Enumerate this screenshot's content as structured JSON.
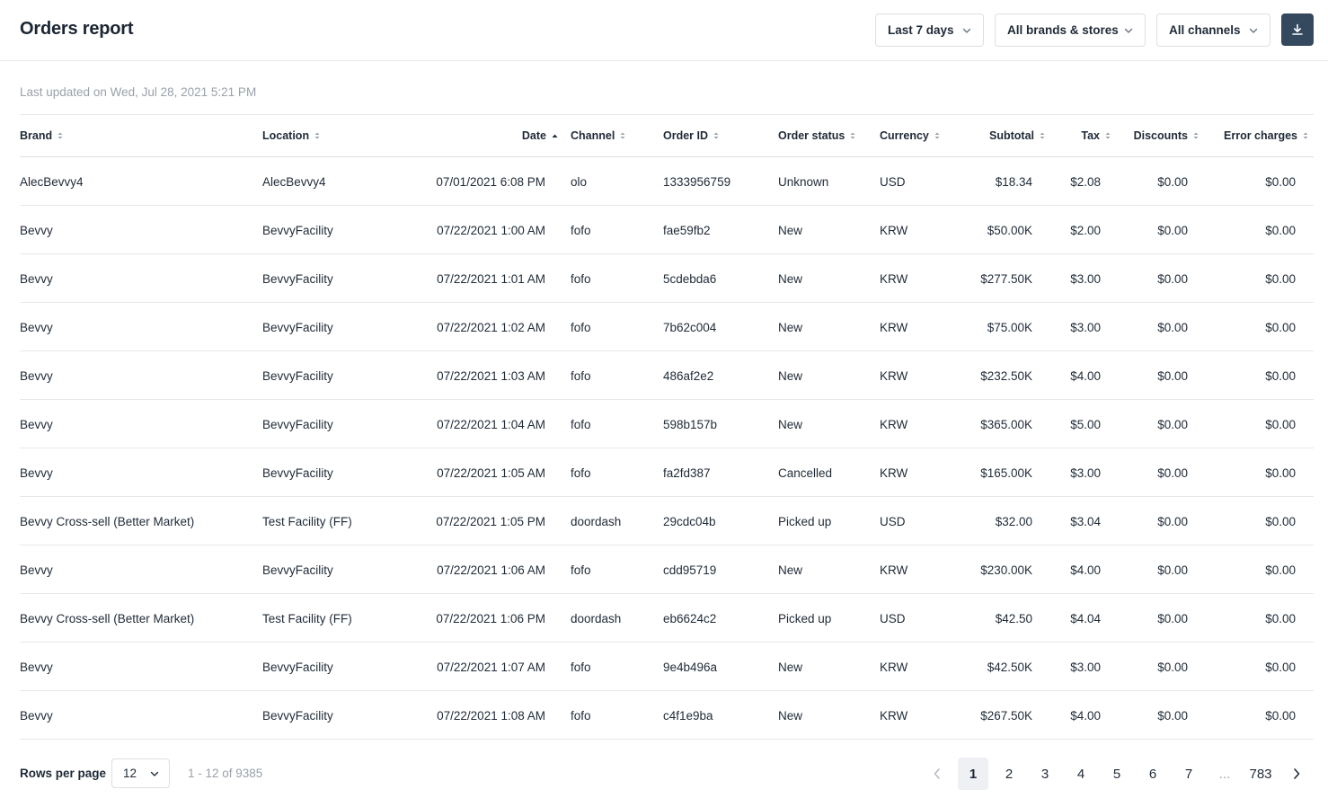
{
  "header": {
    "title": "Orders report",
    "filters": {
      "date_range": "Last 7 days",
      "brands": "All brands & stores",
      "channels": "All channels"
    },
    "download_icon": "download-icon"
  },
  "last_updated": "Last updated on Wed, Jul 28, 2021 5:21 PM",
  "table": {
    "columns": [
      "Brand",
      "Location",
      "Date",
      "Channel",
      "Order ID",
      "Order status",
      "Currency",
      "Subtotal",
      "Tax",
      "Discounts",
      "Error charges"
    ],
    "sorted_by": "Date",
    "sort_direction": "ascending",
    "rows": [
      [
        "AlecBevvy4",
        "AlecBevvy4",
        "07/01/2021 6:08 PM",
        "olo",
        "1333956759",
        "Unknown",
        "USD",
        "$18.34",
        "$2.08",
        "$0.00",
        "$0.00"
      ],
      [
        "Bevvy",
        "BevvyFacility",
        "07/22/2021 1:00 AM",
        "fofo",
        "fae59fb2",
        "New",
        "KRW",
        "$50.00K",
        "$2.00",
        "$0.00",
        "$0.00"
      ],
      [
        "Bevvy",
        "BevvyFacility",
        "07/22/2021 1:01 AM",
        "fofo",
        "5cdebda6",
        "New",
        "KRW",
        "$277.50K",
        "$3.00",
        "$0.00",
        "$0.00"
      ],
      [
        "Bevvy",
        "BevvyFacility",
        "07/22/2021 1:02 AM",
        "fofo",
        "7b62c004",
        "New",
        "KRW",
        "$75.00K",
        "$3.00",
        "$0.00",
        "$0.00"
      ],
      [
        "Bevvy",
        "BevvyFacility",
        "07/22/2021 1:03 AM",
        "fofo",
        "486af2e2",
        "New",
        "KRW",
        "$232.50K",
        "$4.00",
        "$0.00",
        "$0.00"
      ],
      [
        "Bevvy",
        "BevvyFacility",
        "07/22/2021 1:04 AM",
        "fofo",
        "598b157b",
        "New",
        "KRW",
        "$365.00K",
        "$5.00",
        "$0.00",
        "$0.00"
      ],
      [
        "Bevvy",
        "BevvyFacility",
        "07/22/2021 1:05 AM",
        "fofo",
        "fa2fd387",
        "Cancelled",
        "KRW",
        "$165.00K",
        "$3.00",
        "$0.00",
        "$0.00"
      ],
      [
        "Bevvy Cross-sell (Better Market)",
        "Test Facility (FF)",
        "07/22/2021 1:05 PM",
        "doordash",
        "29cdc04b",
        "Picked up",
        "USD",
        "$32.00",
        "$3.04",
        "$0.00",
        "$0.00"
      ],
      [
        "Bevvy",
        "BevvyFacility",
        "07/22/2021 1:06 AM",
        "fofo",
        "cdd95719",
        "New",
        "KRW",
        "$230.00K",
        "$4.00",
        "$0.00",
        "$0.00"
      ],
      [
        "Bevvy Cross-sell (Better Market)",
        "Test Facility (FF)",
        "07/22/2021 1:06 PM",
        "doordash",
        "eb6624c2",
        "Picked up",
        "USD",
        "$42.50",
        "$4.04",
        "$0.00",
        "$0.00"
      ],
      [
        "Bevvy",
        "BevvyFacility",
        "07/22/2021 1:07 AM",
        "fofo",
        "9e4b496a",
        "New",
        "KRW",
        "$42.50K",
        "$3.00",
        "$0.00",
        "$0.00"
      ],
      [
        "Bevvy",
        "BevvyFacility",
        "07/22/2021 1:08 AM",
        "fofo",
        "c4f1e9ba",
        "New",
        "KRW",
        "$267.50K",
        "$4.00",
        "$0.00",
        "$0.00"
      ]
    ]
  },
  "footer": {
    "rows_per_page_label": "Rows per page",
    "rows_per_page_value": "12",
    "range_text": "1 - 12 of 9385",
    "pages": [
      "1",
      "2",
      "3",
      "4",
      "5",
      "6",
      "7",
      "...",
      "783"
    ],
    "current_page": "1"
  },
  "colors": {
    "text": "#1f2a37",
    "muted": "#9aa1aa",
    "border": "#e6e8eb",
    "download_button": "#34495e",
    "active_page_bg": "#eef0f3"
  }
}
